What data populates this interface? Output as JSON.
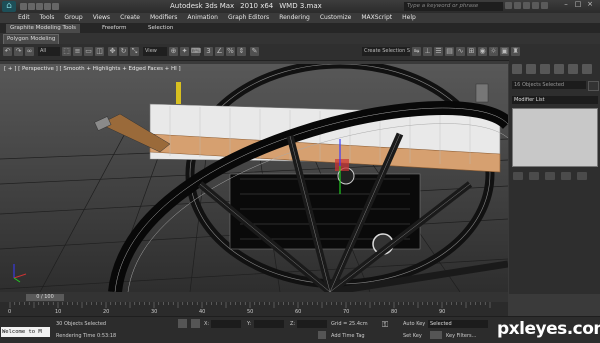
{
  "app": {
    "title_parts": [
      "Autodesk 3ds Max",
      "2010 x64",
      "WMD 3.max"
    ],
    "search_placeholder": "Type a keyword or phrase"
  },
  "menu": [
    "Edit",
    "Tools",
    "Group",
    "Views",
    "Create",
    "Modifiers",
    "Animation",
    "Graph Editors",
    "Rendering",
    "Customize",
    "MAXScript",
    "Help"
  ],
  "ribbon": {
    "tabs": [
      "Graphite Modeling Tools",
      "Freeform",
      "Selection"
    ],
    "subtab": "Polygon Modeling"
  },
  "toolbar": {
    "filter": "All",
    "coord": "View",
    "named_selection": "Create Selection S"
  },
  "viewport": {
    "label": "[ + ] [ Perspective ] [ Smooth + Highlights + Edged Faces + HI ]"
  },
  "command_panel": {
    "object_name": "16 Objects Selected",
    "modifier_list": "Modifier List"
  },
  "timeline": {
    "frame": "0 / 100",
    "ticks": [
      "0",
      "10",
      "20",
      "30",
      "40",
      "50",
      "60",
      "70",
      "80",
      "90"
    ]
  },
  "status": {
    "maxscript": "Welcome to M",
    "objects_selected": "30 Objects Selected",
    "render_time": "Rendering Time 0:53:18",
    "x_label": "X:",
    "y_label": "Y:",
    "z_label": "Z:",
    "grid": "Grid = 25.4cm",
    "add_time_tag": "Add Time Tag",
    "auto_key": "Auto Key",
    "auto_key_value": "Selected",
    "set_key": "Set Key",
    "key_filters": "Key Filters..."
  },
  "watermark": "pxleyes.com",
  "colors": {
    "background": "#3a3a3a",
    "accent": "#1d4f58",
    "highlight": "#d6a070"
  }
}
